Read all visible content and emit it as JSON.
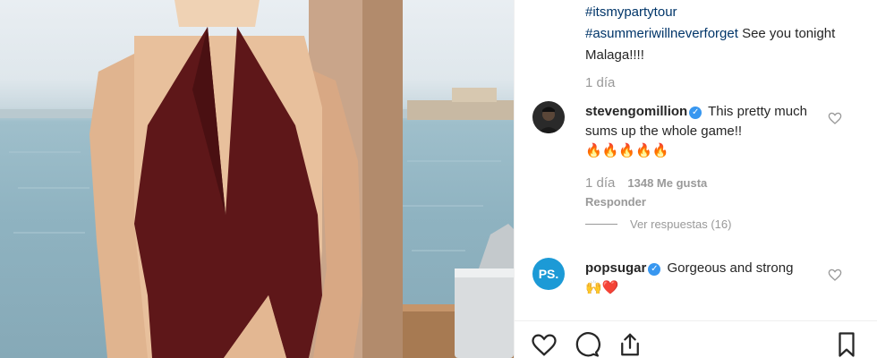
{
  "post": {
    "caption_tag1": "#itsmypartytour",
    "caption_tag2": "#asummeriwillneverforget",
    "caption_text": " See you tonight Malaga!!!!",
    "time": "1 día"
  },
  "comments": [
    {
      "username": "stevengomillion",
      "text": "This pretty much sums up the whole game!!",
      "emoji": "🔥🔥🔥🔥🔥",
      "time": "1 día",
      "likes": "1348 Me gusta",
      "reply_label": "Responder",
      "view_replies": "Ver respuestas (16)"
    },
    {
      "username": "popsugar",
      "avatar_text": "PS.",
      "text": "Gorgeous and strong",
      "emoji": "🙌❤️"
    }
  ],
  "icons": {
    "like": "heart-icon",
    "comment": "comment-bubble-icon",
    "share": "share-icon",
    "save": "bookmark-icon",
    "verified": "verified-badge-icon"
  },
  "colors": {
    "hashtag": "#003569",
    "verified": "#3897f0",
    "popsugar": "#1c9ad6"
  }
}
